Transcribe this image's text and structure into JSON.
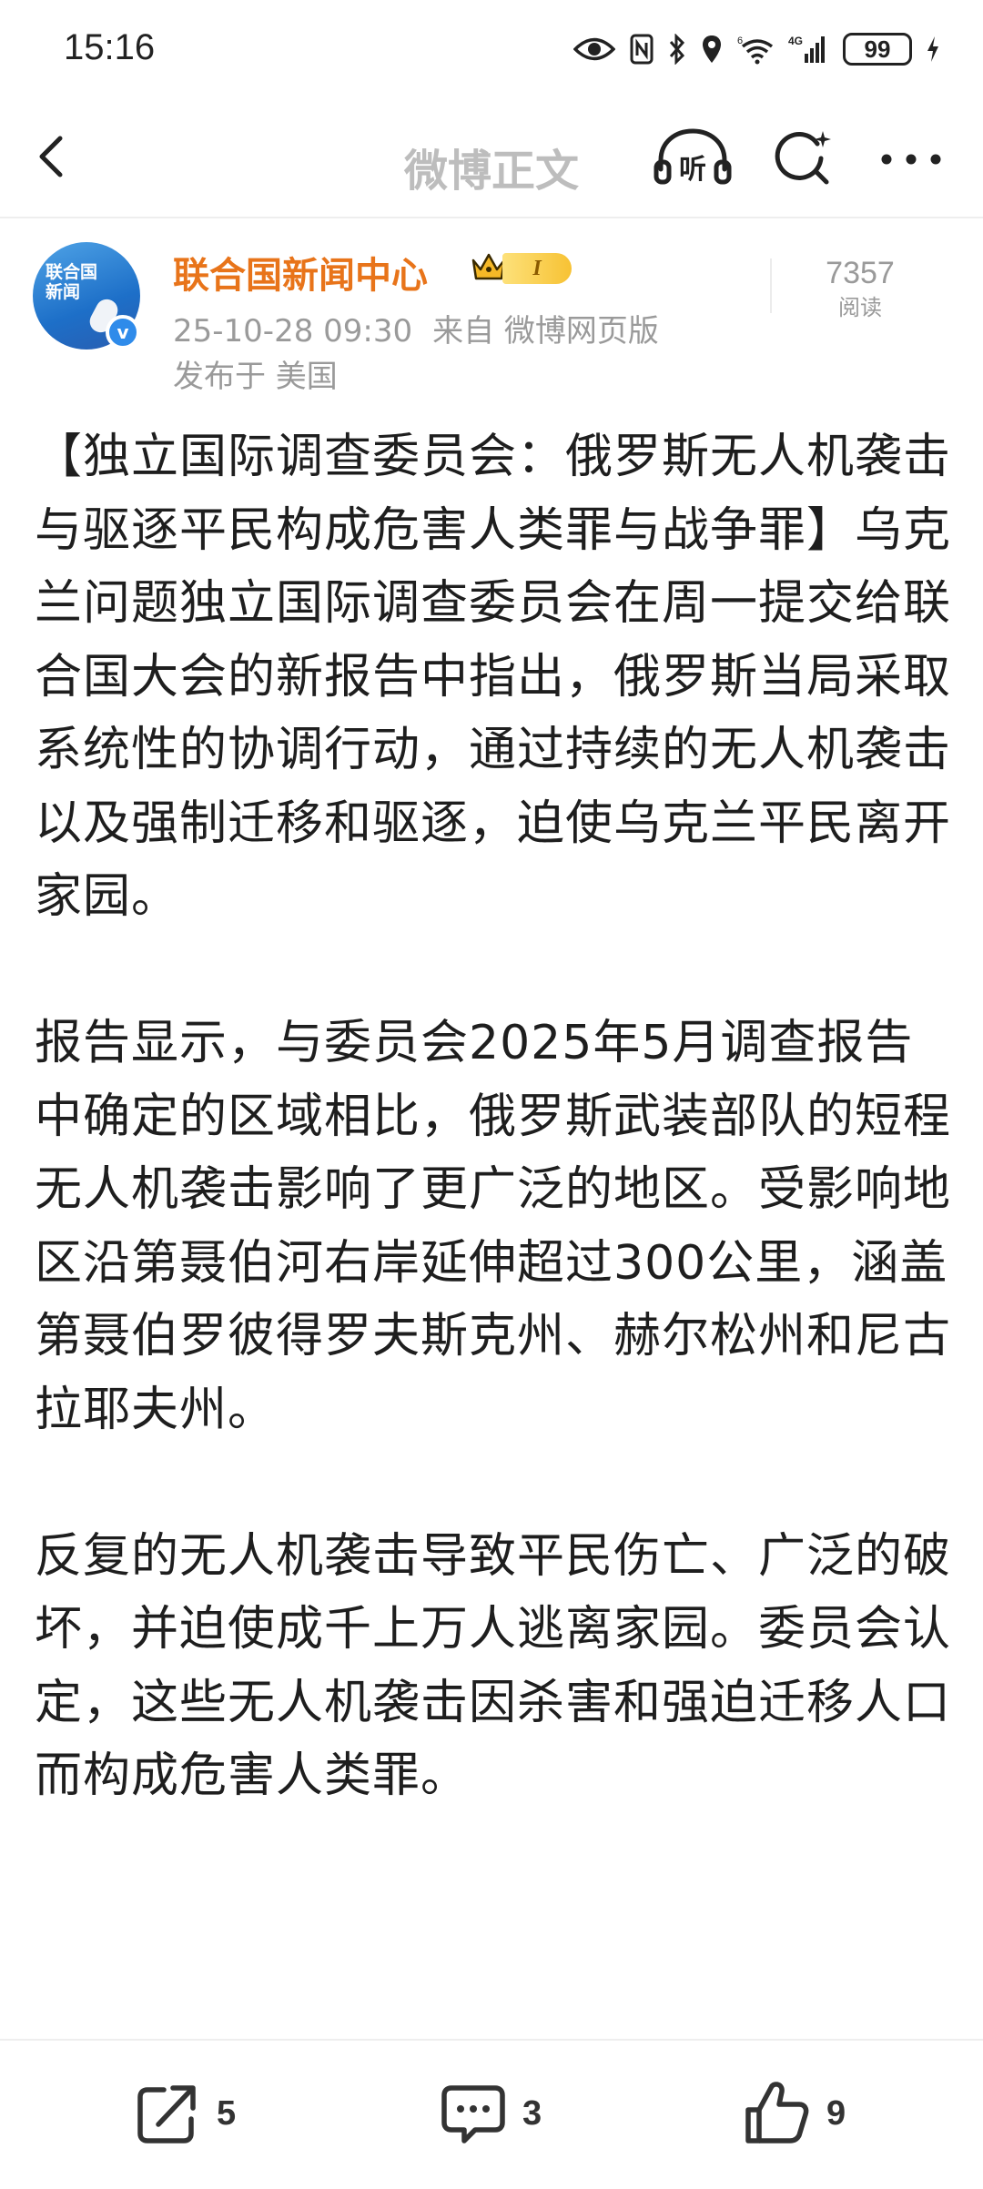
{
  "status_bar": {
    "time": "15:16",
    "network": "4G",
    "signal_label": "6",
    "battery": "99"
  },
  "nav": {
    "title": "微博正文",
    "listen_label": "听"
  },
  "post": {
    "author": "联合国新闻中心",
    "avatar_text_line1": "联合国",
    "avatar_text_line2": "新闻",
    "vip_level": "I",
    "date": "25-10-28 09:30",
    "source": "来自 微博网页版",
    "location": "发布于 美国",
    "read_count": "7357",
    "read_label": "阅读",
    "paragraphs": [
      "【独立国际调查委员会：俄罗斯无人机袭击与驱逐平民构成危害人类罪与战争罪】乌克兰问题独立国际调查委员会在周一提交给联合国大会的新报告中指出，俄罗斯当局采取系统性的协调行动，通过持续的无人机袭击以及强制迁移和驱逐，迫使乌克兰平民离开家园。",
      "报告显示，与委员会2025年5月调查报告中确定的区域相比，俄罗斯武装部队的短程无人机袭击影响了更广泛的地区。受影响地区沿第聂伯河右岸延伸超过300公里，涵盖第聂伯罗彼得罗夫斯克州、赫尔松州和尼古拉耶夫州。",
      "反复的无人机袭击导致平民伤亡、广泛的破坏，并迫使成千上万人逃离家园。委员会认定，这些无人机袭击因杀害和强迫迁移人口而构成危害人类罪。"
    ]
  },
  "actions": {
    "share_count": "5",
    "comment_count": "3",
    "like_count": "9"
  },
  "colors": {
    "author": "#e8741a",
    "meta": "#9a9a9a",
    "nav_title": "#bdbdbd",
    "verified": "#2f8bea"
  }
}
